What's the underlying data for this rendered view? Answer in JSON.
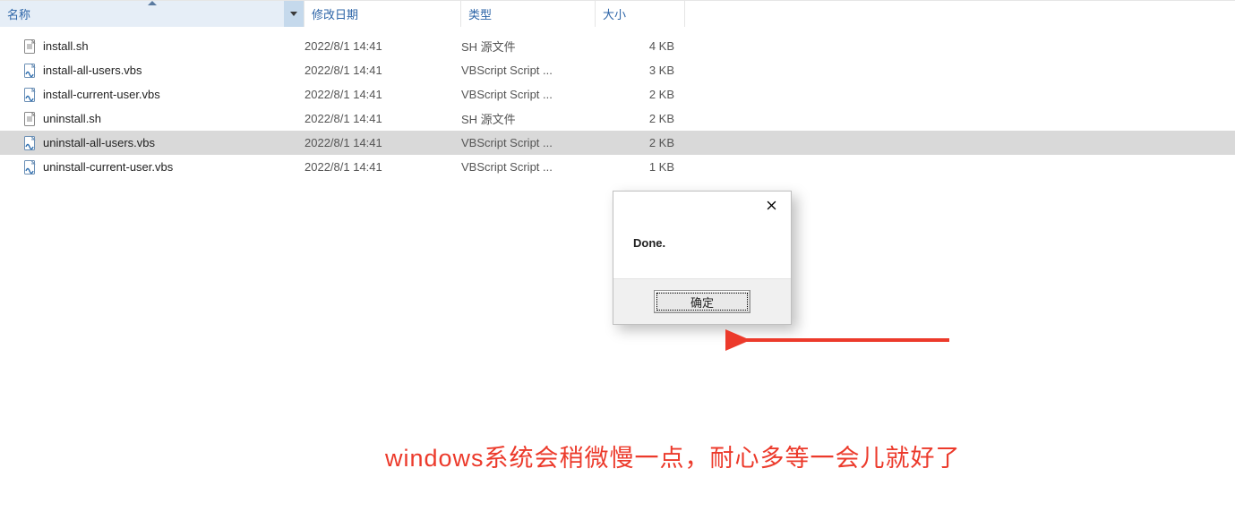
{
  "columns": {
    "name": "名称",
    "date": "修改日期",
    "type": "类型",
    "size": "大小"
  },
  "files": [
    {
      "name": "install.sh",
      "date": "2022/8/1 14:41",
      "type": "SH 源文件",
      "size": "4 KB",
      "icon": "sh",
      "selected": false
    },
    {
      "name": "install-all-users.vbs",
      "date": "2022/8/1 14:41",
      "type": "VBScript Script ...",
      "size": "3 KB",
      "icon": "vbs",
      "selected": false
    },
    {
      "name": "install-current-user.vbs",
      "date": "2022/8/1 14:41",
      "type": "VBScript Script ...",
      "size": "2 KB",
      "icon": "vbs",
      "selected": false
    },
    {
      "name": "uninstall.sh",
      "date": "2022/8/1 14:41",
      "type": "SH 源文件",
      "size": "2 KB",
      "icon": "sh",
      "selected": false
    },
    {
      "name": "uninstall-all-users.vbs",
      "date": "2022/8/1 14:41",
      "type": "VBScript Script ...",
      "size": "2 KB",
      "icon": "vbs",
      "selected": true
    },
    {
      "name": "uninstall-current-user.vbs",
      "date": "2022/8/1 14:41",
      "type": "VBScript Script ...",
      "size": "1 KB",
      "icon": "vbs",
      "selected": false
    }
  ],
  "dialog": {
    "message": "Done.",
    "ok_label": "确定"
  },
  "caption": "windows系统会稍微慢一点，耐心多等一会儿就好了",
  "annotation": {
    "arrow_color": "#ec3a2b"
  }
}
